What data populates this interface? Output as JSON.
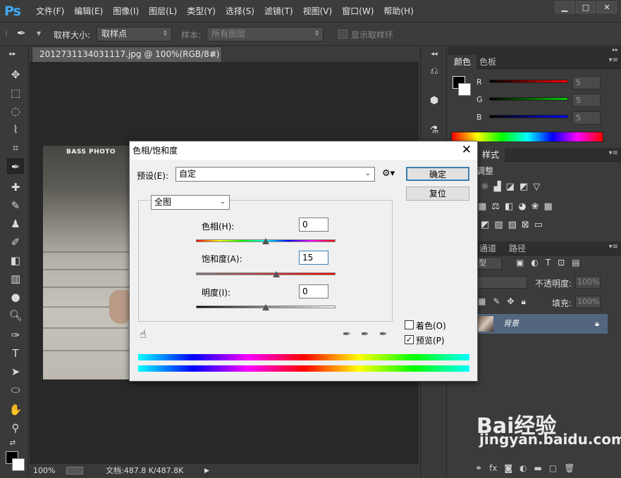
{
  "app": {
    "logo": "Ps"
  },
  "menus": [
    "文件(F)",
    "编辑(E)",
    "图像(I)",
    "图层(L)",
    "类型(Y)",
    "选择(S)",
    "滤镜(T)",
    "视图(V)",
    "窗口(W)",
    "帮助(H)"
  ],
  "window_buttons": {
    "minimize": "▁",
    "maximize": "□",
    "close": "✕"
  },
  "options": {
    "sample_size_label": "取样大小:",
    "sample_size_value": "取样点",
    "sample_label": "样本:",
    "sample_value": "所有图层",
    "show_ring_label": "显示取样环"
  },
  "document": {
    "tab_title": "2012731134031117.jpg @ 100%(RGB/8#) *",
    "tab_close": "×",
    "photo_text": "BASS PHOTO",
    "zoom": "100%",
    "file_info": "文档:487.8 K/487.8K"
  },
  "color_panel": {
    "tab_color": "颜色",
    "tab_swatches": "色板",
    "channels": [
      {
        "label": "R",
        "value": "5",
        "color": "#ff0000"
      },
      {
        "label": "G",
        "value": "5",
        "color": "#00cc00"
      },
      {
        "label": "B",
        "value": "5",
        "color": "#0000ff"
      }
    ]
  },
  "styles_panel": {
    "tab": "样式",
    "subtitle": "调整"
  },
  "layers_panel": {
    "tab_channels": "通道",
    "tab_paths": "路径",
    "filter_type": "型",
    "opacity_label": "不透明度:",
    "opacity_value": "100%",
    "fill_label": "填充:",
    "fill_value": "100%",
    "layer_name": "背景"
  },
  "dialog": {
    "title": "色相/饱和度",
    "close": "✕",
    "preset_label": "预设(E):",
    "preset_value": "自定",
    "ok": "确定",
    "reset": "复位",
    "channel_value": "全图",
    "hue_label": "色相(H):",
    "hue_value": "0",
    "hue_level": 0.5,
    "saturation_label": "饱和度(A):",
    "saturation_value": "15",
    "saturation_level": 0.575,
    "lightness_label": "明度(I):",
    "lightness_value": "0",
    "lightness_level": 0.5,
    "colorize_label": "着色(O)",
    "colorize_checked": false,
    "preview_label": "预览(P)",
    "preview_checked": true
  },
  "watermark": {
    "brand": "Bai经验",
    "url": "jingyan.baidu.com"
  }
}
